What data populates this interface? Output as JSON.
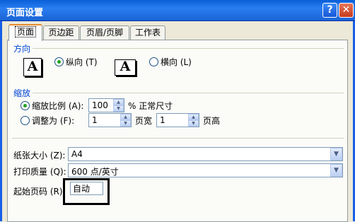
{
  "window": {
    "title": "页面设置",
    "help_glyph": "?",
    "close_glyph": "✕"
  },
  "tabs": [
    {
      "label": "页面",
      "active": true
    },
    {
      "label": "页边距",
      "active": false
    },
    {
      "label": "页眉/页脚",
      "active": false
    },
    {
      "label": "工作表",
      "active": false
    }
  ],
  "orientation": {
    "title": "方向",
    "icon_glyph": "A",
    "portrait_label": "纵向 (T)",
    "landscape_label": "横向 (L)",
    "selected": "portrait"
  },
  "scaling": {
    "title": "缩放",
    "adjust_label": "缩放比例 (A):",
    "adjust_value": "100",
    "percent_label": "% 正常尺寸",
    "fit_label": "调整为 (F):",
    "fit_wide_value": "1",
    "pages_wide_label": "页宽",
    "fit_tall_value": "1",
    "pages_tall_label": "页高",
    "selected": "adjust"
  },
  "paper": {
    "size_label": "纸张大小 (Z):",
    "size_value": "A4"
  },
  "print_quality": {
    "label": "打印质量 (Q):",
    "value": "600 点/英寸"
  },
  "first_page": {
    "label": "起始页码 (R):",
    "value": "自动"
  },
  "arrows": {
    "up": "▲",
    "down": "▼"
  }
}
